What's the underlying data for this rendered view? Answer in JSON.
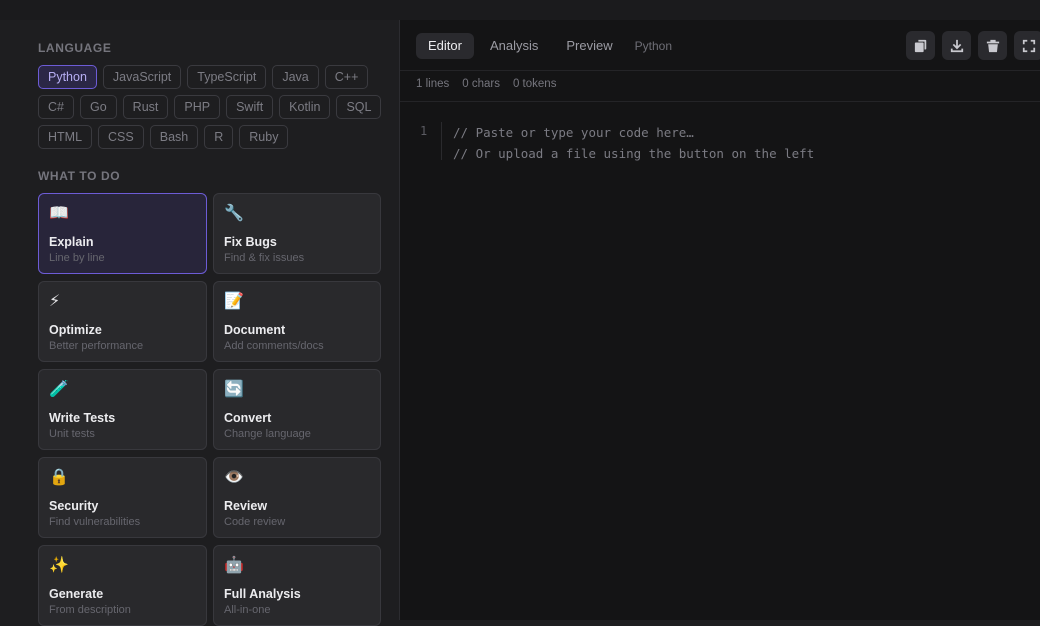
{
  "sidebar": {
    "language_label": "LANGUAGE",
    "languages": [
      [
        "Python",
        "JavaScript",
        "TypeScript",
        "Java",
        "C++"
      ],
      [
        "C#",
        "Go",
        "Rust",
        "PHP",
        "Swift",
        "Kotlin",
        "SQL"
      ],
      [
        "HTML",
        "CSS",
        "Bash",
        "R",
        "Ruby"
      ]
    ],
    "selected_language": "Python",
    "actions_label": "WHAT TO DO",
    "actions": [
      {
        "icon": "📖",
        "icon_name": "open-book-icon",
        "title": "Explain",
        "subtitle": "Line by line",
        "active": true
      },
      {
        "icon": "🔧",
        "icon_name": "wrench-icon",
        "title": "Fix Bugs",
        "subtitle": "Find & fix issues",
        "active": false
      },
      {
        "icon": "⚡",
        "icon_name": "lightning-icon",
        "title": "Optimize",
        "subtitle": "Better performance",
        "active": false
      },
      {
        "icon": "📝",
        "icon_name": "memo-icon",
        "title": "Document",
        "subtitle": "Add comments/docs",
        "active": false
      },
      {
        "icon": "🧪",
        "icon_name": "test-tube-icon",
        "title": "Write Tests",
        "subtitle": "Unit tests",
        "active": false
      },
      {
        "icon": "🔄",
        "icon_name": "refresh-icon",
        "title": "Convert",
        "subtitle": "Change language",
        "active": false
      },
      {
        "icon": "🔒",
        "icon_name": "lock-icon",
        "title": "Security",
        "subtitle": "Find vulnerabilities",
        "active": false
      },
      {
        "icon": "👁️",
        "icon_name": "eye-icon",
        "title": "Review",
        "subtitle": "Code review",
        "active": false
      },
      {
        "icon": "✨",
        "icon_name": "sparkles-icon",
        "title": "Generate",
        "subtitle": "From description",
        "active": false
      },
      {
        "icon": "🤖",
        "icon_name": "robot-icon",
        "title": "Full Analysis",
        "subtitle": "All-in-one",
        "active": false
      }
    ]
  },
  "editor": {
    "tabs": [
      {
        "label": "Editor",
        "active": true
      },
      {
        "label": "Analysis",
        "active": false
      },
      {
        "label": "Preview",
        "active": false
      }
    ],
    "language_tag": "Python",
    "tools": [
      "copy-icon",
      "download-icon",
      "trash-icon",
      "fullscreen-icon"
    ],
    "stats": {
      "lines": "1 lines",
      "chars": "0 chars",
      "tokens": "0 tokens"
    },
    "line_number": "1",
    "placeholder": "// Paste or type your code here…\n// Or upload a file using the button on the left"
  },
  "colors": {
    "accent": "#6d5cd6",
    "panel": "#1e1e20",
    "editor_bg": "#141415"
  }
}
